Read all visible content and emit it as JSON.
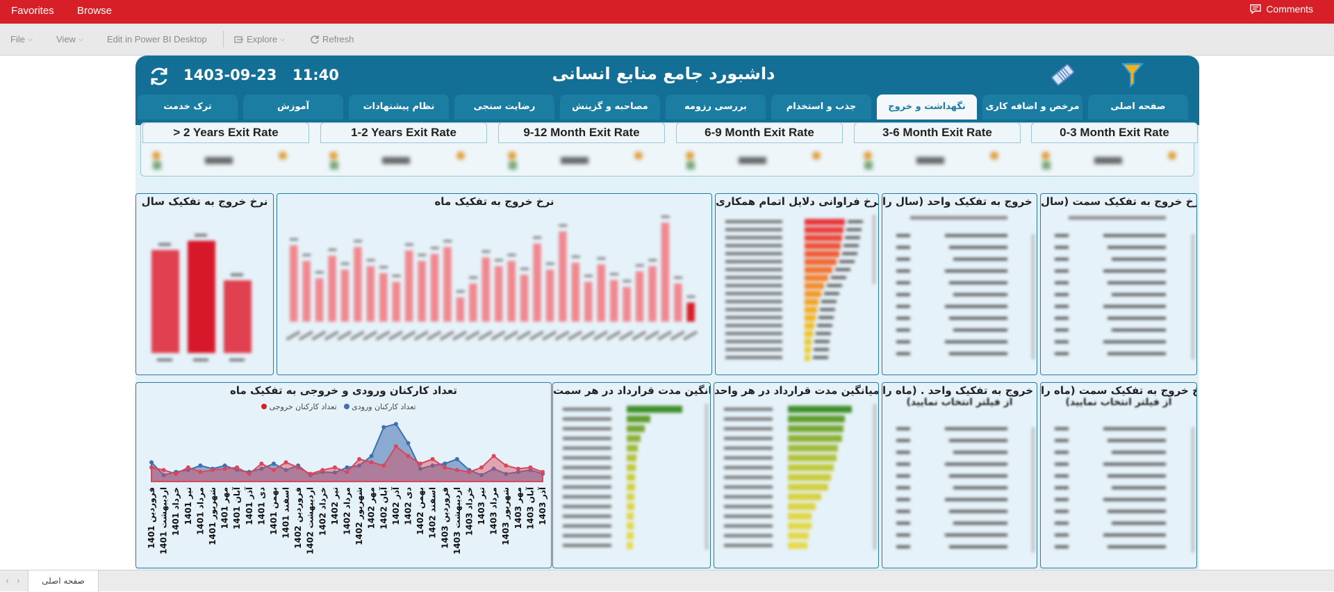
{
  "topbar": {
    "favorites": "Favorites",
    "browse": "Browse",
    "comments": "Comments"
  },
  "toolbar": {
    "file": "File",
    "view": "View",
    "edit": "Edit in Power BI Desktop",
    "explore": "Explore",
    "refresh": "Refresh"
  },
  "header": {
    "title": "داشبورد جامع منابع انسانی",
    "date": "1403-09-23",
    "time": "11:40"
  },
  "tabs": [
    "صفحه اصلی",
    "مرخص و اضافه کاری",
    "نگهداشت و خروج",
    "جذب و استخدام",
    "بررسی رزومه",
    "مصاحبه و گزینش",
    "رضایت سنجی",
    "نظام پیشنهادات",
    "آموزش",
    "ترک خدمت"
  ],
  "active_tab": "نگهداشت و خروج",
  "kpi_titles": [
    "0-3 Month Exit Rate",
    "3-6 Month Exit Rate",
    "6-9 Month Exit Rate",
    "9-12 Month Exit Rate",
    "1-2 Years Exit Rate",
    "> 2 Years Exit Rate"
  ],
  "cards": {
    "year_rate": "نرخ خروج به تفکیک سال",
    "month_rate": "نرخ خروج به تفکیک ماه",
    "reasons": "نرخ فراوانی دلایل اتمام همکاری",
    "unit_year": "نرخ خروج به تفکیک واحد (سال را",
    "position_year": "نرخ خروج به تفکیک سمت (سال",
    "in_out": "تعداد کارکنان ورودی و خروجی به تفکیک ماه",
    "contract_position": "میانگین مدت قرارداد در هر سمت",
    "contract_unit": "میانگین مدت قرارداد در هر واحد",
    "unit_month": "نرخ خروج به تفکیک واحد . (ماه را",
    "unit_month_sub": "(از فیلتر انتخاب نمایید",
    "position_month": "نرخ خروج به تفکیک سمت (ماه را",
    "position_month_sub": "(از فیلتر انتخاب نمایید"
  },
  "legend": {
    "in": "تعداد کارکنان ورودی",
    "out": "تعداد کارکنان خروجی"
  },
  "months": [
    "فروردین 1401",
    "اردیبهشت 1401",
    "خرداد 1401",
    "تیر 1401",
    "مرداد 1401",
    "شهریور 1401",
    "مهر 1401",
    "آبان 1401",
    "آذر 1401",
    "دی 1401",
    "بهمن 1401",
    "اسفند 1401",
    "فروردین 1402",
    "اردیبهشت 1402",
    "خرداد 1402",
    "تیر 1402",
    "مرداد 1402",
    "شهریور 1402",
    "مهر 1402",
    "آبان 1402",
    "آذر 1402",
    "دی 1402",
    "بهمن 1402",
    "اسفند 1402",
    "فروردین 1403",
    "اردیبهشت 1403",
    "خرداد 1403",
    "تیر 1403",
    "مرداد 1403",
    "شهریور 1403",
    "مهر 1403",
    "آبان 1403",
    "آذر 1403"
  ],
  "colors": {
    "brand": "#d71f27",
    "header": "#136f96",
    "tab": "#1c7da3",
    "bar_red": "#e04050",
    "in_area": "#3f6fb0",
    "out_area": "#d9475a"
  },
  "bottom": {
    "page_tab": "صفحه اصلی"
  },
  "chart_data": [
    {
      "type": "bar",
      "title": "نرخ خروج به تفکیک سال",
      "categories": [
        "1401",
        "1402",
        "1403"
      ],
      "values": [
        78,
        85,
        55
      ]
    },
    {
      "type": "bar",
      "title": "نرخ خروج به تفکیک ماه",
      "values": [
        44,
        35,
        25,
        38,
        30,
        43,
        32,
        28,
        23,
        41,
        35,
        39,
        43,
        14,
        22,
        37,
        32,
        35,
        27,
        45,
        30,
        52,
        34,
        23,
        33,
        24,
        20,
        29,
        32,
        57,
        22,
        11
      ]
    },
    {
      "type": "area",
      "title": "تعداد کارکنان ورودی و خروجی به تفکیک ماه",
      "series": [
        {
          "name": "تعداد کارکنان ورودی",
          "values": [
            30,
            10,
            15,
            18,
            25,
            20,
            25,
            18,
            15,
            20,
            28,
            18,
            25,
            10,
            15,
            14,
            22,
            25,
            40,
            85,
            90,
            60,
            20,
            25,
            28,
            35,
            18,
            10,
            20,
            12,
            15,
            18,
            12
          ]
        },
        {
          "name": "تعداد کارکنان خروجی",
          "values": [
            22,
            18,
            12,
            22,
            15,
            18,
            20,
            22,
            12,
            28,
            18,
            30,
            22,
            12,
            18,
            22,
            15,
            35,
            30,
            25,
            55,
            40,
            28,
            35,
            22,
            18,
            15,
            22,
            40,
            25,
            20,
            22,
            15
          ]
        }
      ]
    }
  ]
}
